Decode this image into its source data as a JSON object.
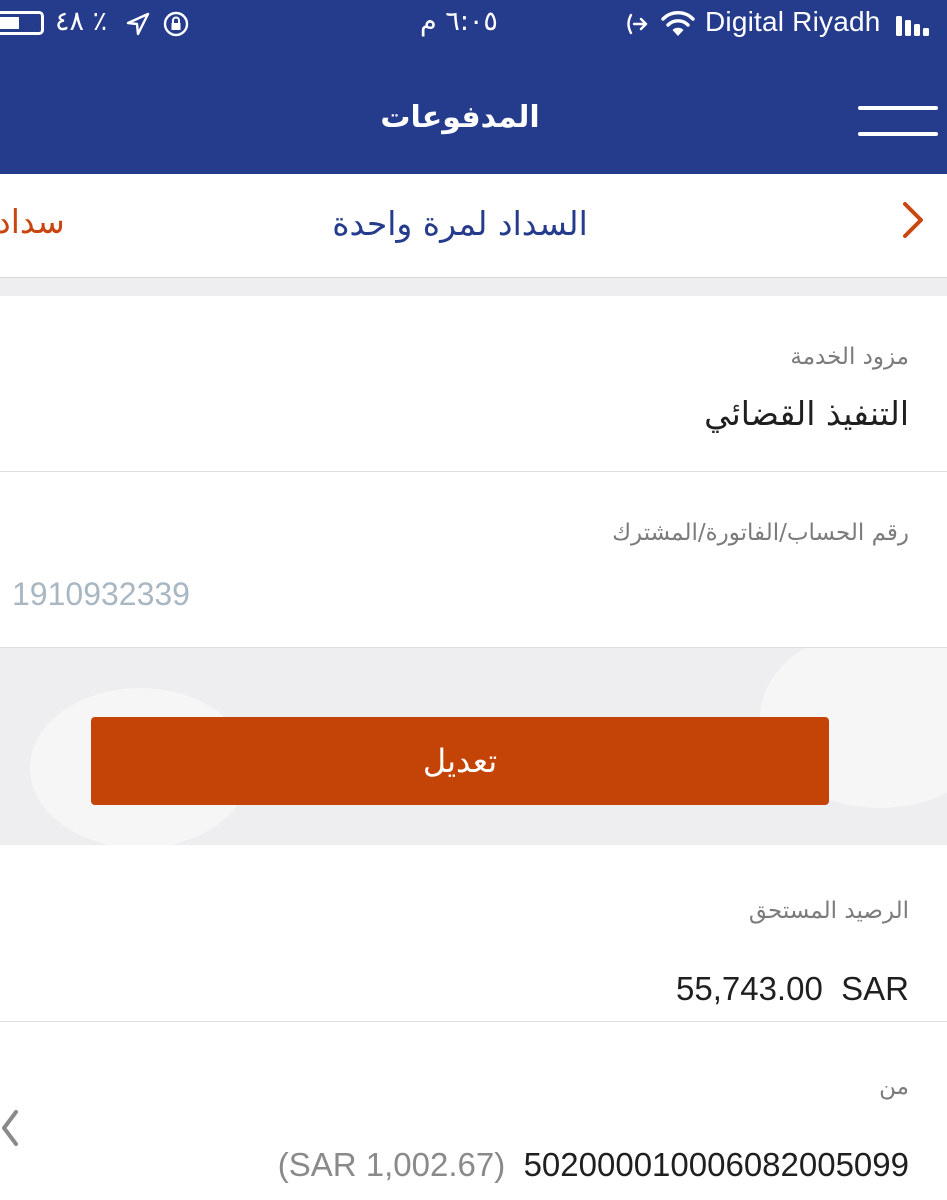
{
  "status_bar": {
    "battery": "٪ ٤٨",
    "time": "٦:٠٥ م",
    "carrier": "Digital Riyadh"
  },
  "icons": {
    "battery": "battery-icon",
    "location": "location-arrow-icon",
    "orientation_lock": "orientation-lock-icon",
    "call_forwarding": "call-forward-icon",
    "wifi": "wifi-icon",
    "signal": "signal-icon",
    "menu": "hamburger-menu-icon",
    "chevron_right": "chevron-right-icon",
    "chevron_left": "chevron-left-icon"
  },
  "header": {
    "title": "المدفوعات"
  },
  "tabs": {
    "active": "السداد لمرة واحدة",
    "next": "سداد"
  },
  "form": {
    "service_provider": {
      "label": "مزود الخدمة",
      "value": "التنفيذ القضائي"
    },
    "account_number": {
      "label": "رقم الحساب/الفاتورة/المشترك",
      "value": "1910932339"
    },
    "edit_button": "تعديل",
    "due_balance": {
      "label": "الرصيد المستحق",
      "amount": "55,743.00",
      "currency": "SAR"
    },
    "from": {
      "label": "من",
      "account": "502000010006082005099",
      "balance": "(SAR 1,002.67)"
    }
  },
  "colors": {
    "header_bg": "#253b8c",
    "tab_active": "#253b8c",
    "accent": "#c44307",
    "label_grey": "#7b7b7b",
    "placeholder": "#a9b7c3"
  }
}
